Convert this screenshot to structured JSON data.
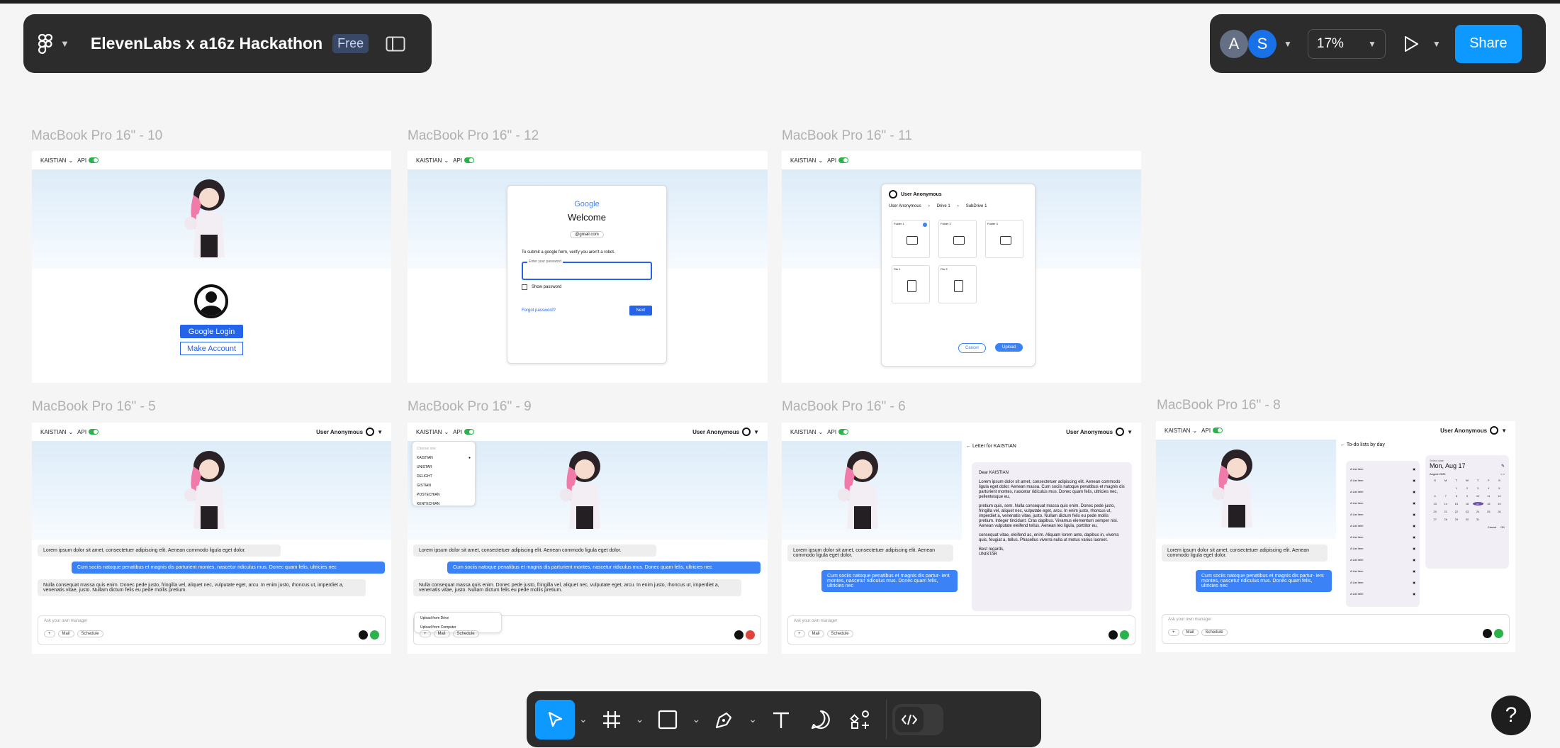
{
  "header": {
    "file_name": "ElevenLabs x a16z Hackathon",
    "plan_badge": "Free",
    "avatars": [
      "A",
      "S"
    ],
    "zoom": "17%",
    "share_label": "Share",
    "colors": {
      "share": "#0d99ff",
      "avatar_a": "#667085",
      "avatar_s": "#1971e8"
    }
  },
  "frames": {
    "f10": {
      "label": "MacBook Pro 16\" - 10",
      "google_login": "Google Login",
      "make_account": "Make Account"
    },
    "f12": {
      "label": "MacBook Pro 16\" - 12",
      "google": "Google",
      "welcome": "Welcome",
      "email": "@gmail.com",
      "verify": "To submit a google form, verify you aren't a robot.",
      "pw_placeholder": "Enter your password",
      "show_pw": "Show password",
      "forgot": "Forgot password?",
      "next": "Next"
    },
    "f11": {
      "label": "MacBook Pro 16\" - 11",
      "user": "User Anonymous",
      "crumbs": [
        "User Anonymous",
        "Drive 1",
        "SubDrive 1"
      ],
      "folders": [
        "Folder 1",
        "Folder 2",
        "Folder 3"
      ],
      "files": [
        "File 1",
        "File 2"
      ],
      "cancel": "Cancel",
      "upload": "Upload"
    },
    "f5": {
      "label": "MacBook Pro 16\" - 5"
    },
    "f9": {
      "label": "MacBook Pro 16\" - 9",
      "choose": "Choose one",
      "options": [
        "KAISTIAN",
        "UNISTAR",
        "DELIGHT",
        "GISTIAN",
        "POSTECHIAN",
        "KENTECHIAN"
      ],
      "upload_drive": "Upload from Drive",
      "upload_computer": "Upload from Computer"
    },
    "f6": {
      "label": "MacBook Pro 16\" - 6",
      "letter_title": "Letter for KAISTIAN",
      "dear": "Dear KAISTIAN",
      "p1": "Lorem ipsum dolor sit amet, consectetuer adipiscing elit. Aenean commodo ligula eget dolor. Aenean massa. Cum sociis natoque penatibus et magnis dis parturient montes, nascetur ridiculus mus. Donec quam felis, ultricies nec, pellentesque eu,",
      "p2": "pretium quis, sem. Nulla consequat massa quis enim. Donec pede justo, fringilla vel, aliquet nec, vulputate eget, arcu. In enim justo, rhoncus ut, imperdiet a, venenatis vitae, justo. Nullam dictum felis eu pede mollis pretium. Integer tincidunt. Cras dapibus. Vivamus elementum semper nisi. Aenean vulputate eleifend tellus. Aenean leo ligula, porttitor eu,",
      "p3": "consequat vitae, eleifend ac, enim. Aliquam lorem ante, dapibus in, viverra quis, feugiat a, tellus. Phasellus viverra nulla ut metus varius laoreet.",
      "regards": "Best regards,",
      "sign": "UNISTAR",
      "chat1": "Lorem ipsum dolor sit amet, consectetuer adipiscing elit. Aenean commodo ligula eget dolor.",
      "chat2": "Cum sociis natoque penatibus et magnis dis partur- ient montes, nascetur ridiculus mus. Donec quam felis, ultricies nec"
    },
    "f8": {
      "label": "MacBook Pro 16\" - 8",
      "todo": "To-do lists by day",
      "list_item": "List item",
      "select_date": "Select date",
      "date": "Mon, Aug 17",
      "month": "August 2025",
      "weekdays": [
        "S",
        "M",
        "T",
        "W",
        "T",
        "F",
        "S"
      ],
      "cancel": "Cancel",
      "ok": "OK"
    }
  },
  "common": {
    "school": "KAISTIAN",
    "api": "API",
    "user": "User Anonymous",
    "msg1": "Lorem ipsum dolor sit amet, consectetuer adipiscing elit. Aenean commodo ligula eget dolor.",
    "msg2": "Cum sociis natoque penatibus et magnis dis parturient montes, nascetur ridiculus mus. Donec quam felis, ultricies nec",
    "msg3": "Nulla consequat massa quis enim. Donec pede justo, fringilla vel, aliquet nec, vulputate eget, arcu. In enim justo, rhoncus ut, imperdiet a, venenatis vitae, justo. Nullam dictum felis eu pede mollis pretium.",
    "ask": "Ask your own manager",
    "mail": "Mail",
    "schedule": "Schedule"
  },
  "toolbar": {
    "tools": [
      "move-tool",
      "frame-tool",
      "shape-tool",
      "pen-tool",
      "text-tool",
      "comment-tool",
      "actions-tool",
      "dev-mode-toggle"
    ]
  },
  "help": "?"
}
